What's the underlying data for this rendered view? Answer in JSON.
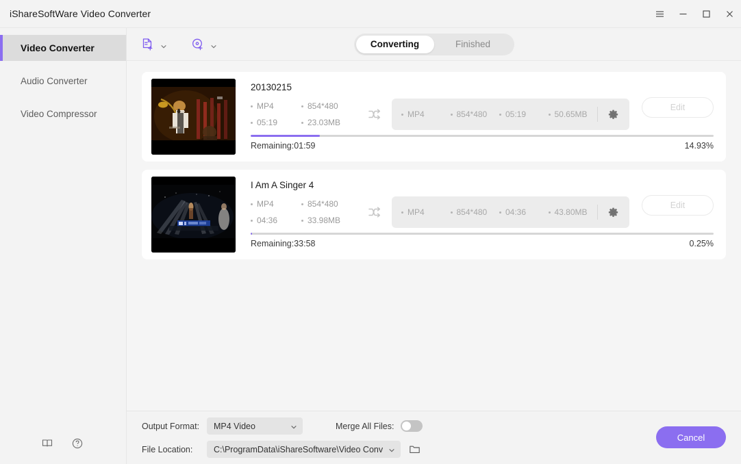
{
  "window": {
    "title": "iShareSoftWare Video Converter",
    "controls": [
      {
        "name": "menu-button",
        "icon": "hamburger-icon"
      },
      {
        "name": "minimize-button",
        "icon": "minimize-icon"
      },
      {
        "name": "maximize-button",
        "icon": "maximize-icon"
      },
      {
        "name": "close-button",
        "icon": "close-icon"
      }
    ]
  },
  "sidebar": {
    "items": [
      {
        "label": "Video Converter",
        "active": true
      },
      {
        "label": "Audio Converter",
        "active": false
      },
      {
        "label": "Video Compressor",
        "active": false
      }
    ],
    "bottom_icons": [
      {
        "name": "book-icon"
      },
      {
        "name": "help-icon"
      }
    ]
  },
  "toolbar": {
    "add_file": {
      "label": "",
      "icon": "add-file-icon"
    },
    "add_disc": {
      "label": "",
      "icon": "add-disc-icon"
    },
    "tabs": [
      {
        "label": "Converting",
        "active": true
      },
      {
        "label": "Finished",
        "active": false
      }
    ]
  },
  "tasks": [
    {
      "name": "20130215",
      "source": {
        "format": "MP4",
        "resolution": "854*480",
        "duration": "05:19",
        "size": "23.03MB"
      },
      "target": {
        "format": "MP4",
        "resolution": "854*480",
        "duration": "05:19",
        "size": "50.65MB"
      },
      "edit_label": "Edit",
      "remaining": "Remaining:01:59",
      "percent_label": "14.93%",
      "percent_value": 14.93
    },
    {
      "name": "I Am A Singer 4",
      "source": {
        "format": "MP4",
        "resolution": "854*480",
        "duration": "04:36",
        "size": "33.98MB"
      },
      "target": {
        "format": "MP4",
        "resolution": "854*480",
        "duration": "04:36",
        "size": "43.80MB"
      },
      "edit_label": "Edit",
      "remaining": "Remaining:33:58",
      "percent_label": "0.25%",
      "percent_value": 0.25
    }
  ],
  "footer": {
    "output_format_label": "Output Format:",
    "output_format_value": "MP4 Video",
    "merge_label": "Merge All Files:",
    "merge_enabled": false,
    "file_location_label": "File Location:",
    "file_location_value": "C:\\ProgramData\\iShareSoftware\\Video Conve",
    "folder_icon": "folder-icon",
    "cancel_label": "Cancel"
  },
  "colors": {
    "accent": "#8b6ef0",
    "window_bg": "#f3f3f3",
    "list_bg": "#f5f5f5",
    "card_bg": "#ffffff",
    "meta_box_bg": "#ececec",
    "progress_track": "#d6d6d6"
  }
}
